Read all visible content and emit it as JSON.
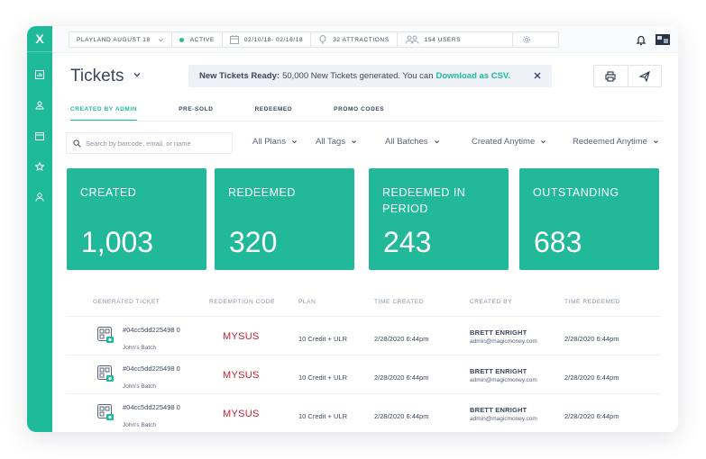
{
  "app": {
    "logo": "X",
    "sidebar_icons": [
      "chart-icon",
      "users-icon",
      "calendar-icon",
      "star-icon",
      "user-icon"
    ]
  },
  "topbar": {
    "park": "PLAYLAND AUGUST 18",
    "status": "ACTIVE",
    "date_range": "02/10/18- 02/16/18",
    "attractions": "32 ATTRACTIONS",
    "users": "154 USERS",
    "status_color": "#27c07d"
  },
  "page": {
    "title": "Tickets"
  },
  "banner": {
    "bold": "New Tickets Ready:",
    "text": "50,000 New Tickets generated. You can",
    "link": "Download as CSV."
  },
  "tabs": [
    {
      "label": "CREATED BY ADMIN",
      "active": true
    },
    {
      "label": "PRE-SOLD",
      "active": false
    },
    {
      "label": "REDEEMED",
      "active": false
    },
    {
      "label": "PROMO CODES",
      "active": false
    }
  ],
  "filters": {
    "search_placeholder": "Search by barcode, email, or name",
    "plans": "All Plans",
    "tags": "All Tags",
    "batches": "All Batches",
    "created": "Created Anytime",
    "redeemed": "Redeemed Anytime"
  },
  "stats": [
    {
      "label": "CREATED",
      "value": "1,003"
    },
    {
      "label": "REDEEMED",
      "value": "320"
    },
    {
      "label": "REDEEMED IN PERIOD",
      "value": "243"
    },
    {
      "label": "OUTSTANDING",
      "value": "683"
    }
  ],
  "table": {
    "headers": [
      "GENERATED TICKET",
      "REDEMPTION CODE",
      "PLAN",
      "TIME CREATED",
      "CREATED BY",
      "TIME REDEEMED"
    ],
    "rows": [
      {
        "ticket": "#04cc5dd225498 0",
        "batch": "John's Batch",
        "code": "MYSUS",
        "plan": "10 Credit + ULR",
        "created": "2/28/2020 6:44pm",
        "by_name": "BRETT ENRIGHT",
        "by_email": "admin@magicmoney.com",
        "redeemed": "2/28/2020 6:44pm"
      },
      {
        "ticket": "#04cc5dd225498 0",
        "batch": "John's Batch",
        "code": "MYSUS",
        "plan": "10 Credit + ULR",
        "created": "2/28/2020 6:44pm",
        "by_name": "BRETT ENRIGHT",
        "by_email": "admin@magicmoney.com",
        "redeemed": "2/28/2020 6:44pm"
      },
      {
        "ticket": "#04cc5dd225498 0",
        "batch": "John's Batch",
        "code": "MYSUS",
        "plan": "10 Credit + ULR",
        "created": "2/28/2020 6:44pm",
        "by_name": "BRETT ENRIGHT",
        "by_email": "admin@magicmoney.com",
        "redeemed": "2/28/2020 6:44pm"
      }
    ]
  },
  "colors": {
    "brand": "#1fba9a",
    "code": "#c0203a"
  }
}
